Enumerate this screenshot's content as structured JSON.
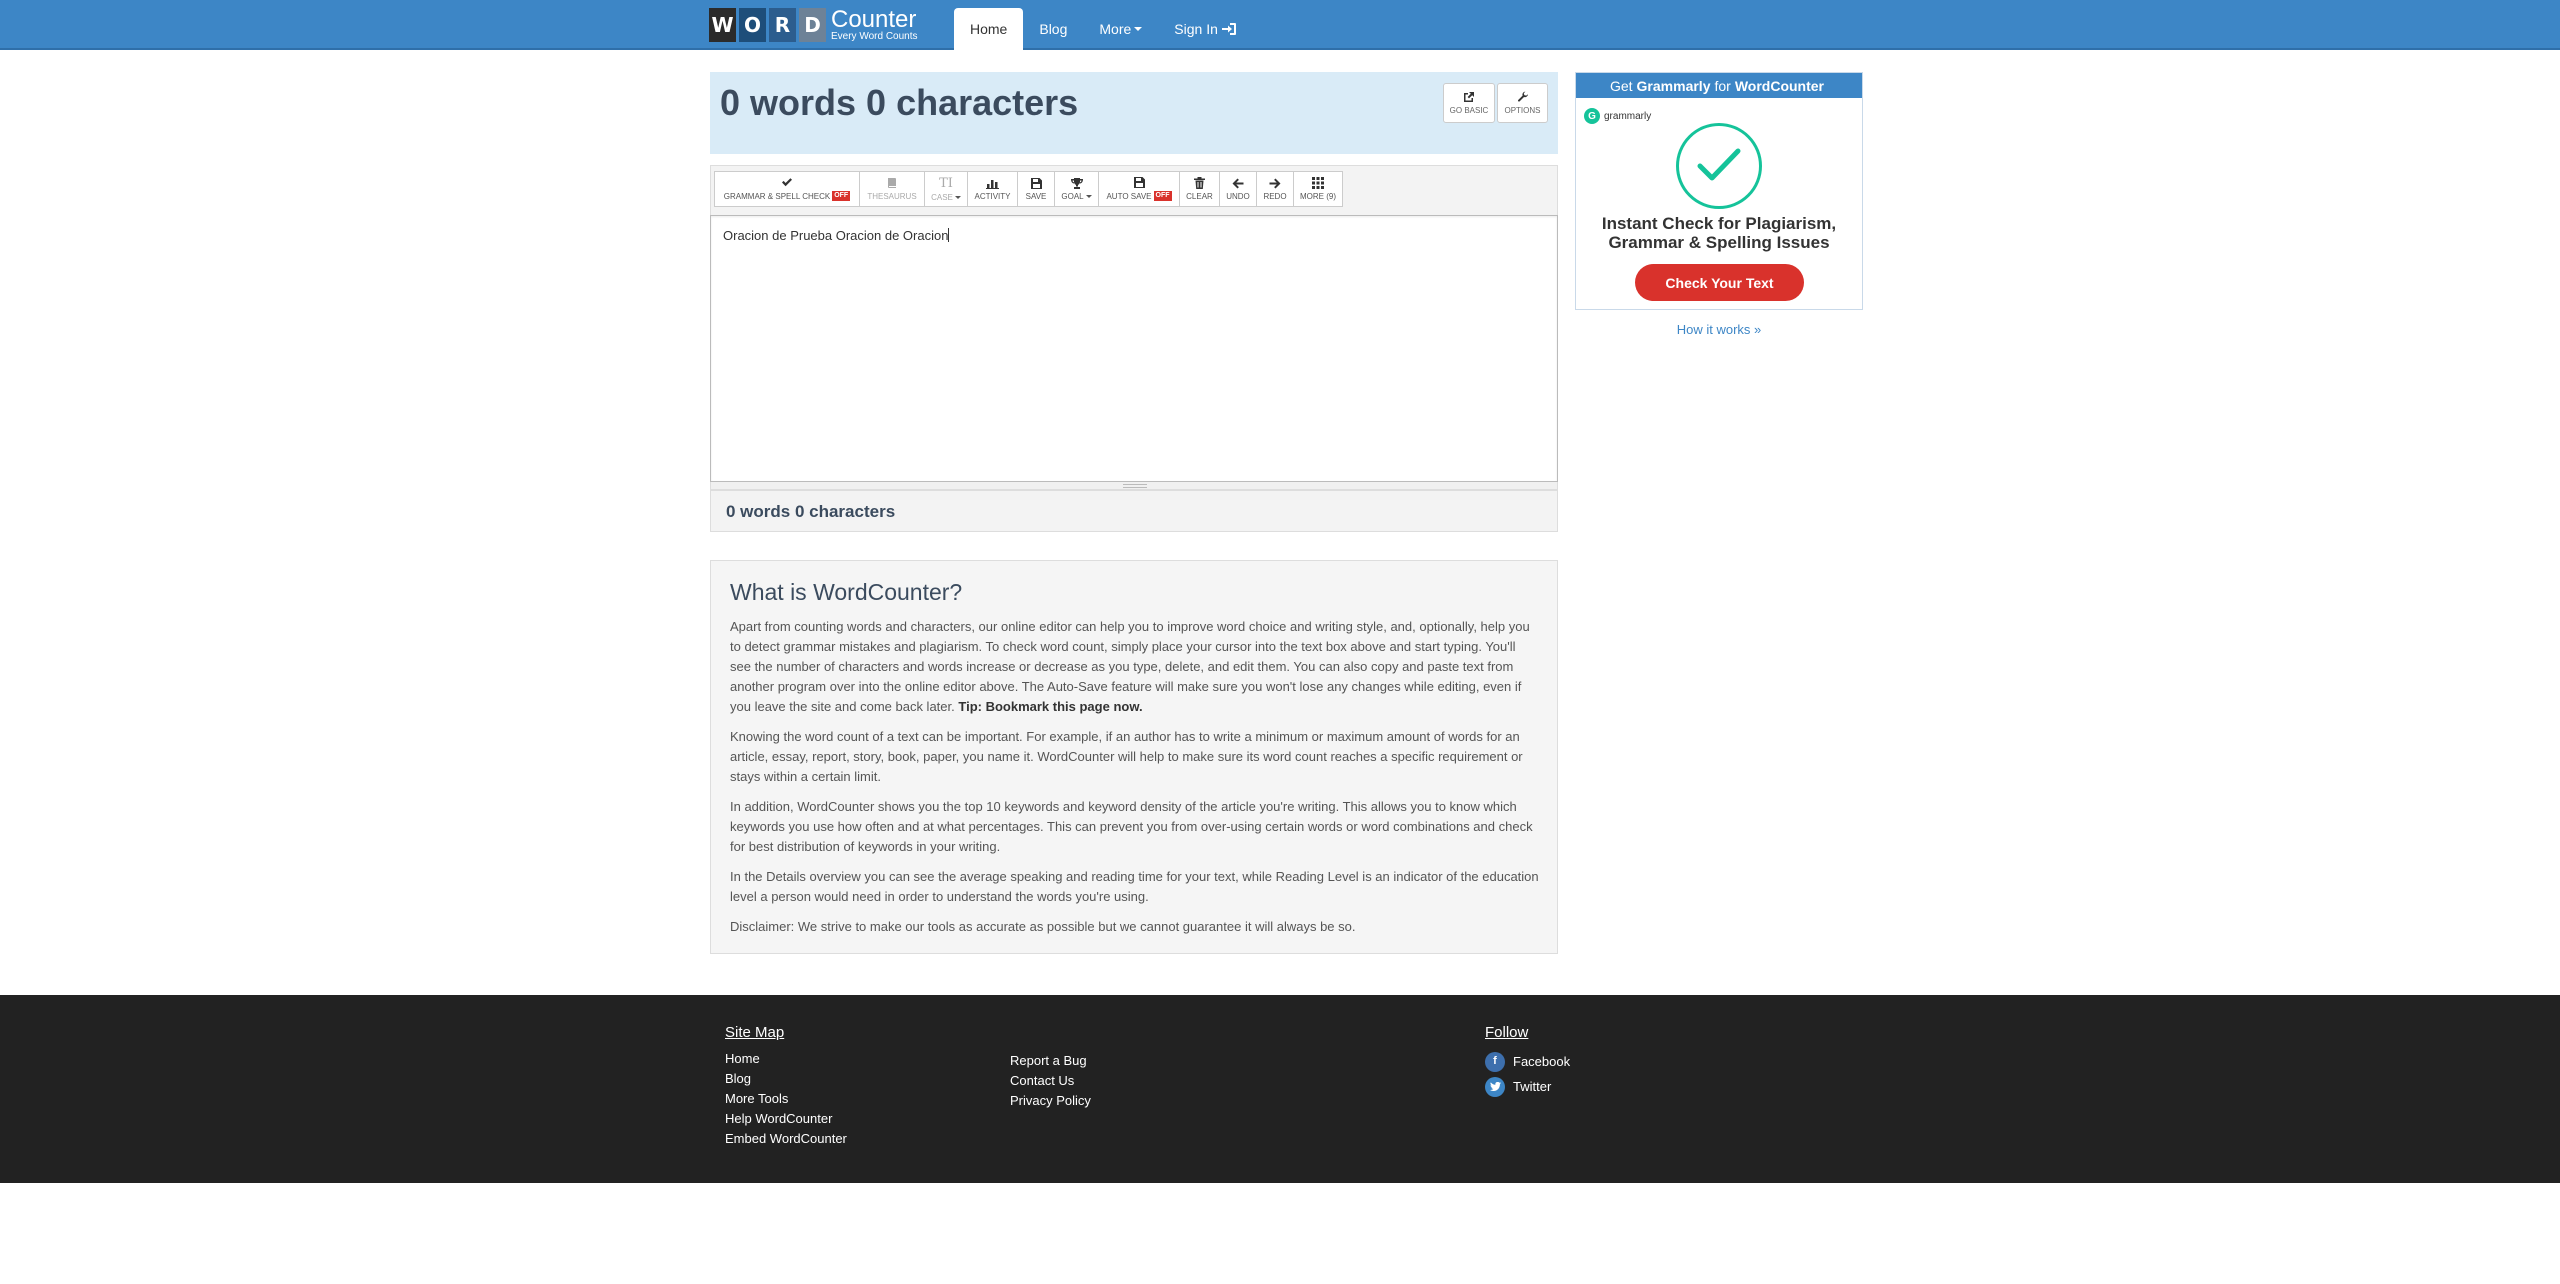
{
  "logo": {
    "letters": [
      "W",
      "O",
      "R",
      "D"
    ],
    "brand": "Counter",
    "tagline": "Every Word Counts"
  },
  "nav": {
    "home": "Home",
    "blog": "Blog",
    "more": "More",
    "signin": "Sign In"
  },
  "counter": {
    "title": "0 words 0 characters",
    "go_basic": "GO BASIC",
    "options": "OPTIONS"
  },
  "toolbar": {
    "grammar": "GRAMMAR & SPELL CHECK",
    "grammar_state": "OFF",
    "thesaurus": "THESAURUS",
    "case": "CASE",
    "activity": "ACTIVITY",
    "save": "SAVE",
    "goal": "GOAL",
    "autosave": "AUTO SAVE",
    "autosave_state": "OFF",
    "clear": "CLEAR",
    "undo": "UNDO",
    "redo": "REDO",
    "more": "MORE (9)"
  },
  "editor": {
    "text": "Oracion de Prueba Oracion de Oracion"
  },
  "bottom_count": "0 words 0 characters",
  "info": {
    "title": "What is WordCounter?",
    "p1": "Apart from counting words and characters, our online editor can help you to improve word choice and writing style, and, optionally, help you to detect grammar mistakes and plagiarism. To check word count, simply place your cursor into the text box above and start typing. You'll see the number of characters and words increase or decrease as you type, delete, and edit them. You can also copy and paste text from another program over into the online editor above. The Auto-Save feature will make sure you won't lose any changes while editing, even if you leave the site and come back later.",
    "p1_tip": "Tip: Bookmark this page now.",
    "p2": "Knowing the word count of a text can be important. For example, if an author has to write a minimum or maximum amount of words for an article, essay, report, story, book, paper, you name it. WordCounter will help to make sure its word count reaches a specific requirement or stays within a certain limit.",
    "p3": "In addition, WordCounter shows you the top 10 keywords and keyword density of the article you're writing. This allows you to know which keywords you use how often and at what percentages. This can prevent you from over-using certain words or word combinations and check for best distribution of keywords in your writing.",
    "p4": "In the Details overview you can see the average speaking and reading time for your text, while Reading Level is an indicator of the education level a person would need in order to understand the words you're using.",
    "p5": "Disclaimer: We strive to make our tools as accurate as possible but we cannot guarantee it will always be so."
  },
  "ad": {
    "head_pre": "Get",
    "head_brand": "Grammarly",
    "head_mid": "for",
    "head_site": "WordCounter",
    "g_letter": "G",
    "g_name": "grammarly",
    "title": "Instant Check for Plagiarism, Grammar & Spelling Issues",
    "button": "Check Your Text",
    "how": "How it works »"
  },
  "footer": {
    "sitemap_title": "Site Map",
    "sitemap": [
      "Home",
      "Blog",
      "More Tools",
      "Help WordCounter",
      "Embed WordCounter"
    ],
    "misc": [
      "Report a Bug",
      "Contact Us",
      "Privacy Policy"
    ],
    "follow_title": "Follow",
    "facebook": "Facebook",
    "twitter": "Twitter"
  },
  "colors": {
    "nav_blue": "#3d86c6",
    "header_bg": "#d9ebf7",
    "grammarly_green": "#15c39a",
    "cta_red": "#d9322c",
    "footer_bg": "#222222"
  },
  "icons": {
    "signin": "sign-in-icon",
    "grammar": "checkmark-icon",
    "thesaurus": "book-icon",
    "case": "text-case-icon",
    "activity": "bar-chart-icon",
    "save": "floppy-icon",
    "goal": "trophy-icon",
    "clear": "trash-icon",
    "undo": "arrow-left-icon",
    "redo": "arrow-right-icon",
    "more": "grid-icon"
  }
}
